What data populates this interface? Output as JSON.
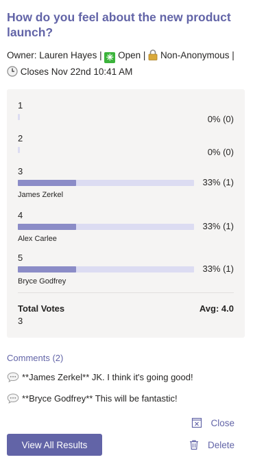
{
  "poll": {
    "title": "How do you feel about the new product launch?",
    "owner_text": "Owner: Lauren Hayes |",
    "status": "Open |",
    "anonymity": "Non-Anonymous |",
    "closes": "Closes Nov 22nd 10:41 AM"
  },
  "results": {
    "options": [
      {
        "label": "1",
        "percent_text": "0% (0)",
        "fraction": 0,
        "voter": ""
      },
      {
        "label": "2",
        "percent_text": "0% (0)",
        "fraction": 0,
        "voter": ""
      },
      {
        "label": "3",
        "percent_text": "33% (1)",
        "fraction": 0.33,
        "voter": "James Zerkel"
      },
      {
        "label": "4",
        "percent_text": "33% (1)",
        "fraction": 0.33,
        "voter": "Alex Carlee"
      },
      {
        "label": "5",
        "percent_text": "33% (1)",
        "fraction": 0.33,
        "voter": "Bryce Godfrey"
      }
    ],
    "total_label": "Total Votes",
    "total_value": "3",
    "avg": "Avg: 4.0"
  },
  "comments": {
    "heading": "Comments (2)",
    "items": [
      {
        "text": "**James Zerkel** JK. I think it's going good!"
      },
      {
        "text": "**Bryce Godfrey** This will be fantastic!"
      }
    ]
  },
  "actions": {
    "close_label": "Close",
    "delete_label": "Delete",
    "view_all_label": "View All Results"
  },
  "colors": {
    "accent": "#6264a7",
    "bar_fill": "#8b8cc7",
    "bar_track": "#dcdcf2",
    "open_badge": "#3bb33b"
  },
  "icons": [
    "open-checkbox-icon",
    "lock-icon",
    "clock-icon",
    "comment-bubble-icon",
    "close-box-icon",
    "trash-icon"
  ]
}
